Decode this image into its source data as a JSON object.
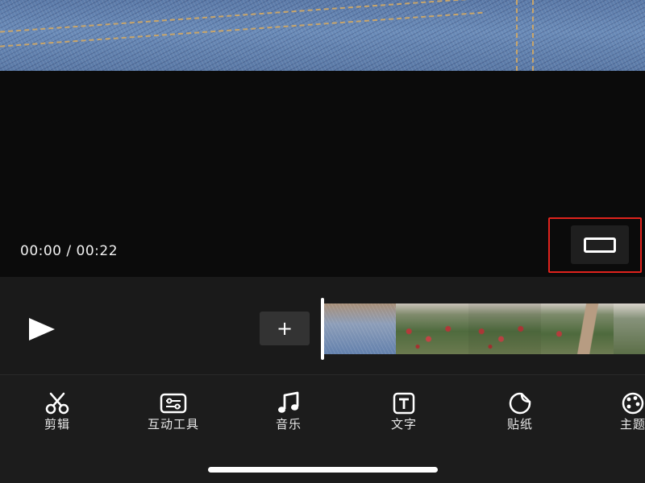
{
  "player": {
    "current_time": "00:00",
    "separator": "/",
    "duration": "00:22",
    "timecode": "00:00 / 00:22"
  },
  "timeline": {
    "add_clip_label": "+"
  },
  "toolbar": {
    "items": [
      {
        "label": "剪辑",
        "icon": "scissors-icon"
      },
      {
        "label": "互动工具",
        "icon": "sliders-icon"
      },
      {
        "label": "音乐",
        "icon": "music-note-icon"
      },
      {
        "label": "文字",
        "icon": "text-box-icon"
      },
      {
        "label": "贴纸",
        "icon": "sticker-icon"
      },
      {
        "label": "主题",
        "icon": "palette-icon"
      }
    ]
  },
  "colors": {
    "highlight": "#e0231d",
    "background": "#121212",
    "toolbar": "#1c1c1c"
  }
}
